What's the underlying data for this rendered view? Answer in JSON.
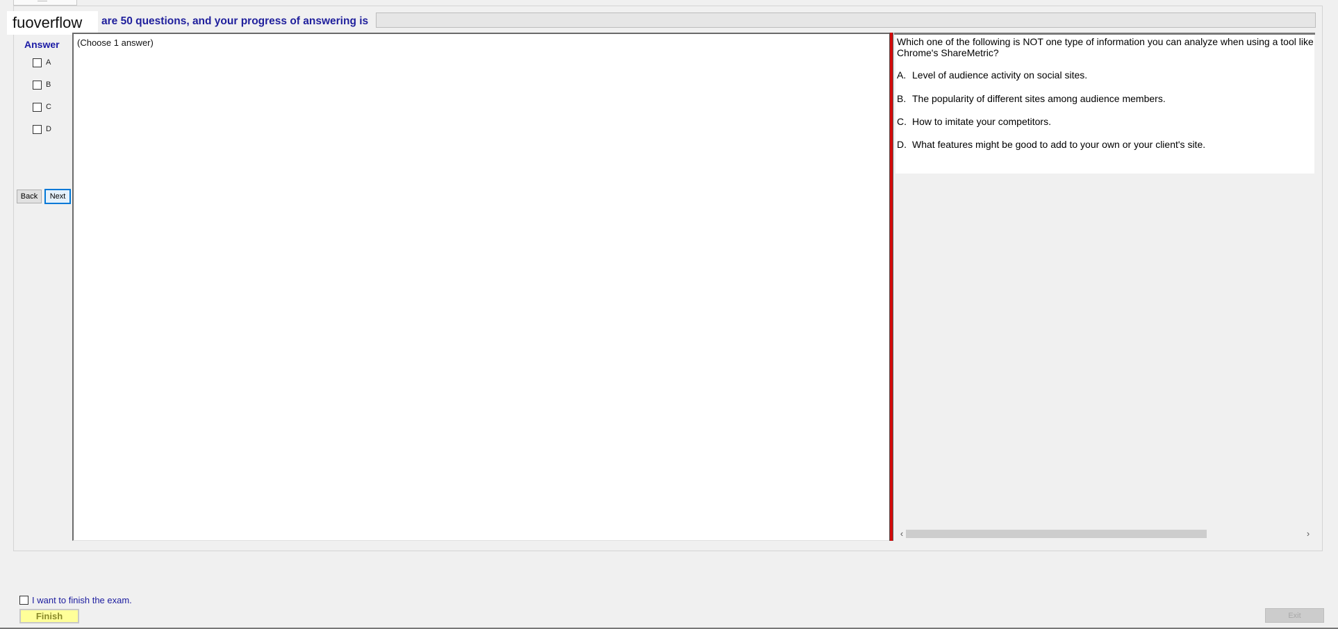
{
  "watermark": "fuoverflow",
  "header": {
    "progress_label": "are 50 questions, and your progress of answering is",
    "progress_value": 0
  },
  "answer_panel": {
    "heading": "Answer",
    "options": [
      "A",
      "B",
      "C",
      "D"
    ],
    "back_label": "Back",
    "next_label": "Next"
  },
  "answer_area": {
    "hint": "(Choose 1 answer)"
  },
  "question": {
    "text": "Which one of the following is NOT one type of information you can analyze when using a tool like Chrome's ShareMetric?",
    "choices": [
      {
        "key": "A.",
        "text": "Level of audience activity on social sites."
      },
      {
        "key": "B.",
        "text": "The popularity of different sites among audience members."
      },
      {
        "key": "C.",
        "text": "How to imitate your competitors."
      },
      {
        "key": "D.",
        "text": "What features might be good to add to your own or your client's site."
      }
    ]
  },
  "footer": {
    "finish_check_label": "I want to finish the exam.",
    "finish_label": "Finish",
    "exit_label": "Exit"
  },
  "colors": {
    "splitter": "#d30b0b",
    "heading_blue": "#1a1aa5",
    "finish_bg": "#ffff99"
  }
}
